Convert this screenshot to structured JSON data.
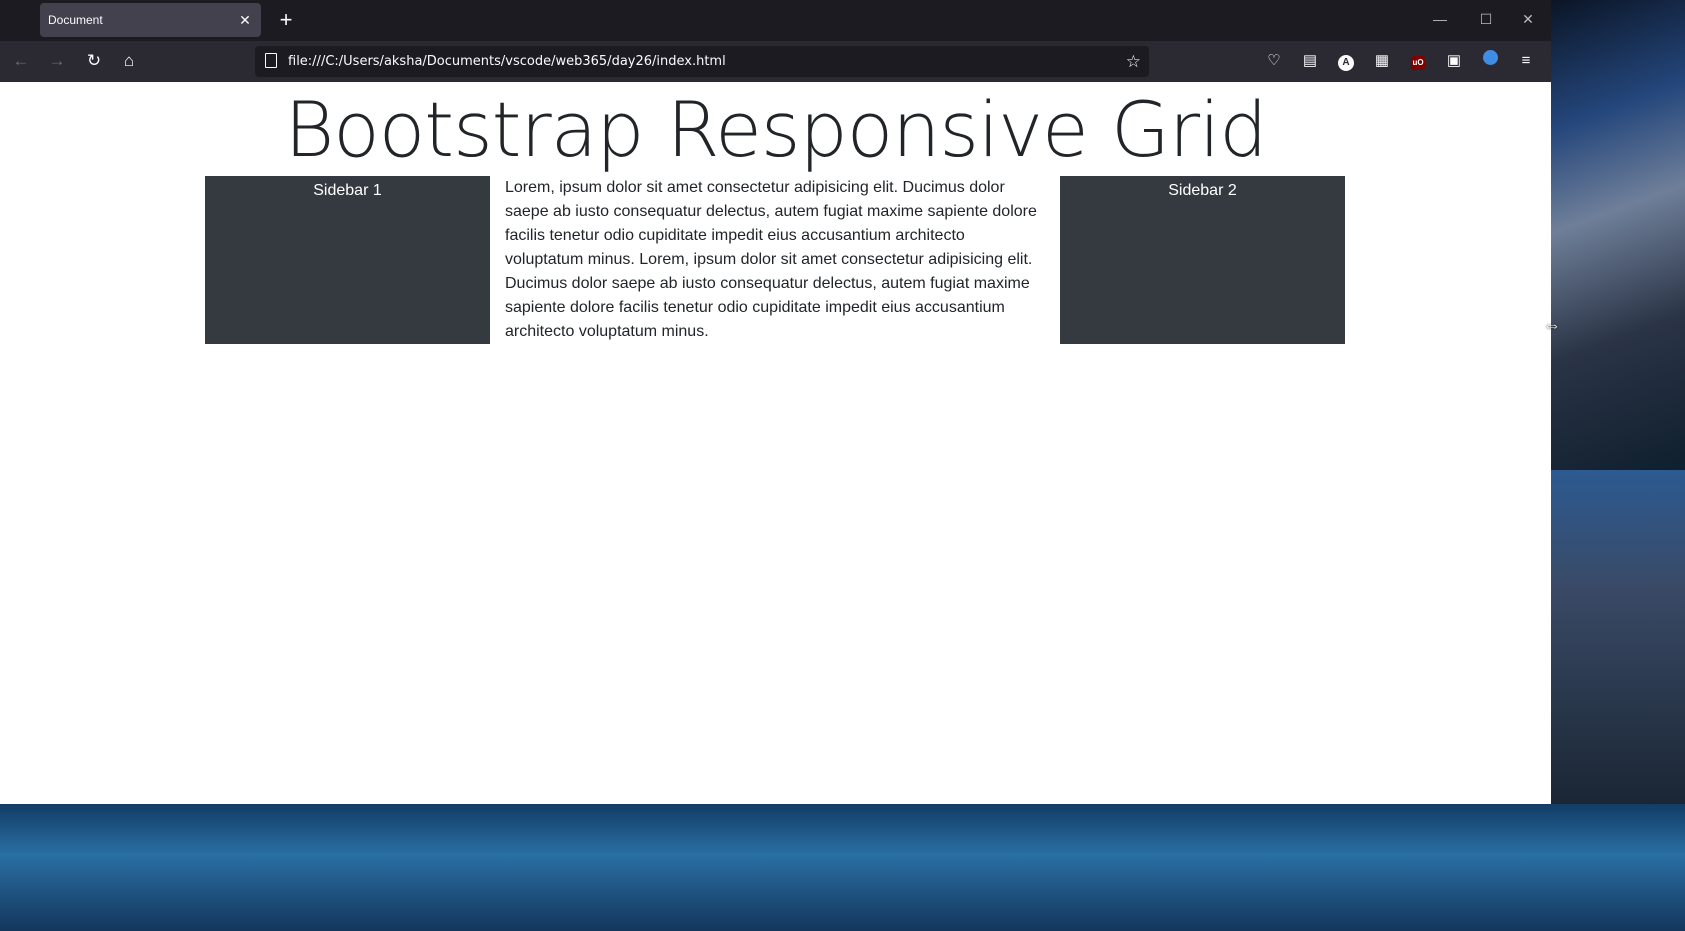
{
  "tab": {
    "title": "Document",
    "close": "✕",
    "new_tab": "+"
  },
  "window_controls": {
    "minimize": "—",
    "maximize": "☐",
    "close": "✕"
  },
  "nav": {
    "back": "←",
    "forward": "→",
    "reload": "↻",
    "home": "⌂",
    "url": "file:///C:/Users/aksha/Documents/vscode/web365/day26/index.html",
    "bookmark": "☆"
  },
  "toolbar": {
    "pocket": "♡",
    "reader": "▤",
    "account_letter": "A",
    "extensions": "▦",
    "ublock": "uO",
    "container": "▣",
    "menu": "≡"
  },
  "page": {
    "heading": "Bootstrap Responsive Grid",
    "sidebar1": "Sidebar 1",
    "sidebar2": "Sidebar 2",
    "main_text": "Lorem, ipsum dolor sit amet consectetur adipisicing elit. Ducimus dolor saepe ab iusto consequatur delectus, autem fugiat maxime sapiente dolore facilis tenetur odio cupiditate impedit eius accusantium architecto voluptatum minus. Lorem, ipsum dolor sit amet consectetur adipisicing elit. Ducimus dolor saepe ab iusto consequatur delectus, autem fugiat maxime sapiente dolore facilis tenetur odio cupiditate impedit eius accusantium architecto voluptatum minus."
  },
  "cursor": "⇔",
  "colors": {
    "sidebar_bg": "#343a40",
    "tabbar_bg": "#1c1b22",
    "navbar_bg": "#2b2a33"
  }
}
